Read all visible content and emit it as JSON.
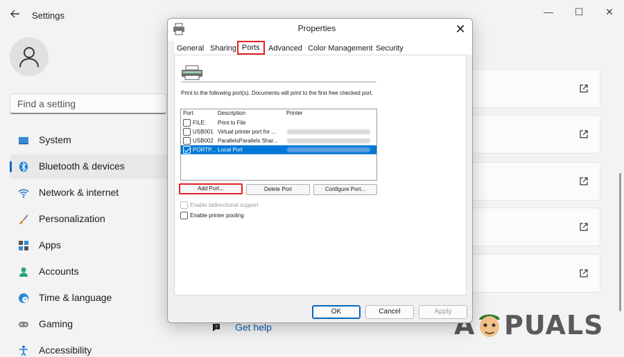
{
  "settings": {
    "title": "Settings",
    "search_placeholder": "Find a setting",
    "nav": [
      {
        "label": "System",
        "icon": "monitor-icon",
        "active": false
      },
      {
        "label": "Bluetooth & devices",
        "icon": "bluetooth-icon",
        "active": true
      },
      {
        "label": "Network & internet",
        "icon": "wifi-icon",
        "active": false
      },
      {
        "label": "Personalization",
        "icon": "brush-icon",
        "active": false
      },
      {
        "label": "Apps",
        "icon": "apps-icon",
        "active": false
      },
      {
        "label": "Accounts",
        "icon": "person-icon",
        "active": false
      },
      {
        "label": "Time & language",
        "icon": "globe-clock-icon",
        "active": false
      },
      {
        "label": "Gaming",
        "icon": "gamepad-icon",
        "active": false
      },
      {
        "label": "Accessibility",
        "icon": "accessibility-icon",
        "active": false
      }
    ],
    "get_help": "Get help",
    "accent": "#0067c0"
  },
  "dialog": {
    "title": "Properties",
    "tabs": [
      "General",
      "Sharing",
      "Ports",
      "Advanced",
      "Color Management",
      "Security"
    ],
    "active_tab": "Ports",
    "description": "Print to the following port(s). Documents will print to the first free checked port.",
    "columns": [
      "Port",
      "Description",
      "Printer"
    ],
    "ports": [
      {
        "port": "FILE:",
        "description": "Print to File",
        "checked": false,
        "selected": false
      },
      {
        "port": "USB001",
        "description": "Virtual printer port for ...",
        "checked": false,
        "selected": false
      },
      {
        "port": "USB002",
        "description": "ParallelsParallels Shar...",
        "checked": false,
        "selected": false
      },
      {
        "port": "PORTP...",
        "description": "Local Port",
        "checked": true,
        "selected": true
      }
    ],
    "buttons": {
      "add_port": "Add Port...",
      "delete_port": "Delete Port",
      "configure_port": "Configure Port..."
    },
    "enable_bidirectional": "Enable bidirectional support",
    "enable_pooling": "Enable printer pooling",
    "ok": "OK",
    "cancel": "Cancel",
    "apply": "Apply",
    "highlight_color": "#e41e1e",
    "selection_color": "#0078d7"
  },
  "watermark": {
    "letter_a": "A",
    "rest": "PUALS"
  }
}
